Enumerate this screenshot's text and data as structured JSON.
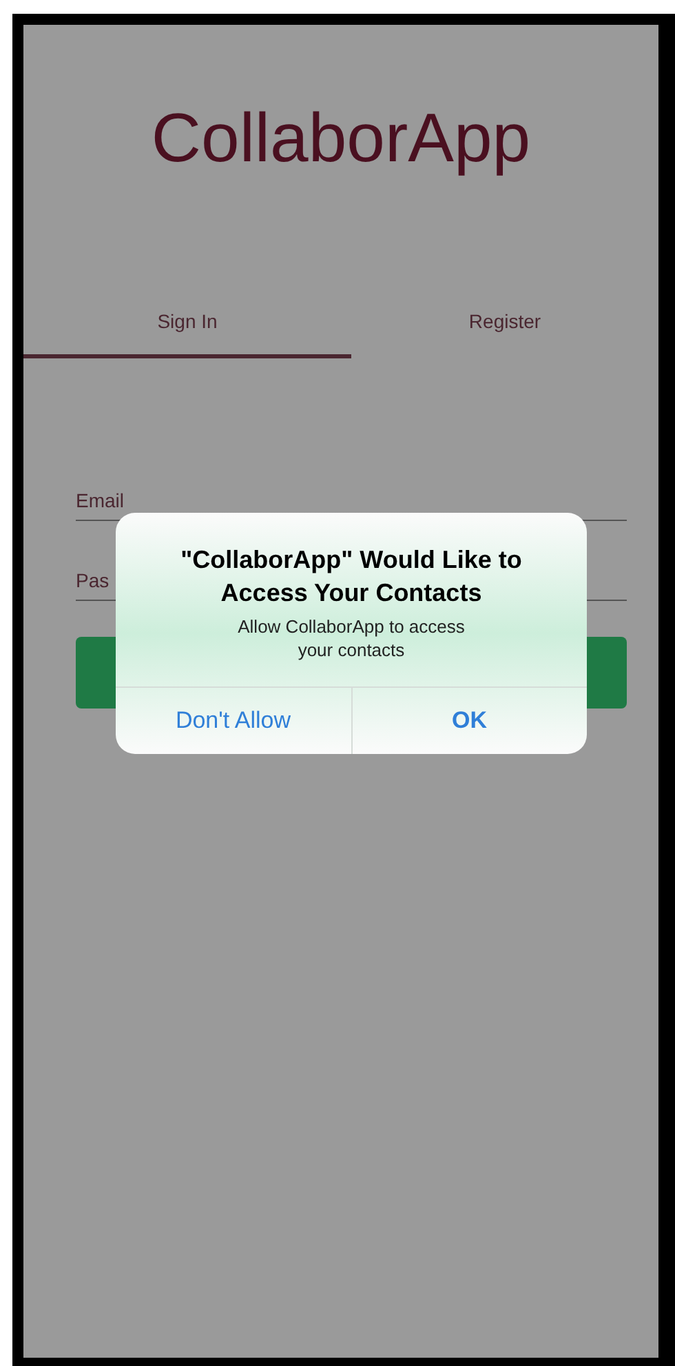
{
  "app_title": "CollaborApp",
  "tabs": [
    {
      "label": "Sign In",
      "selected": true
    },
    {
      "label": "Register",
      "selected": false
    }
  ],
  "fields": [
    {
      "label": "Email"
    },
    {
      "label": "Pas"
    }
  ],
  "alert": {
    "title": "\"CollaborApp\" Would Like to Access Your Contacts",
    "message": "Allow CollaborApp to access your contacts",
    "buttons": [
      {
        "label": "Don't Allow",
        "bold": false
      },
      {
        "label": "OK",
        "bold": true
      }
    ]
  }
}
